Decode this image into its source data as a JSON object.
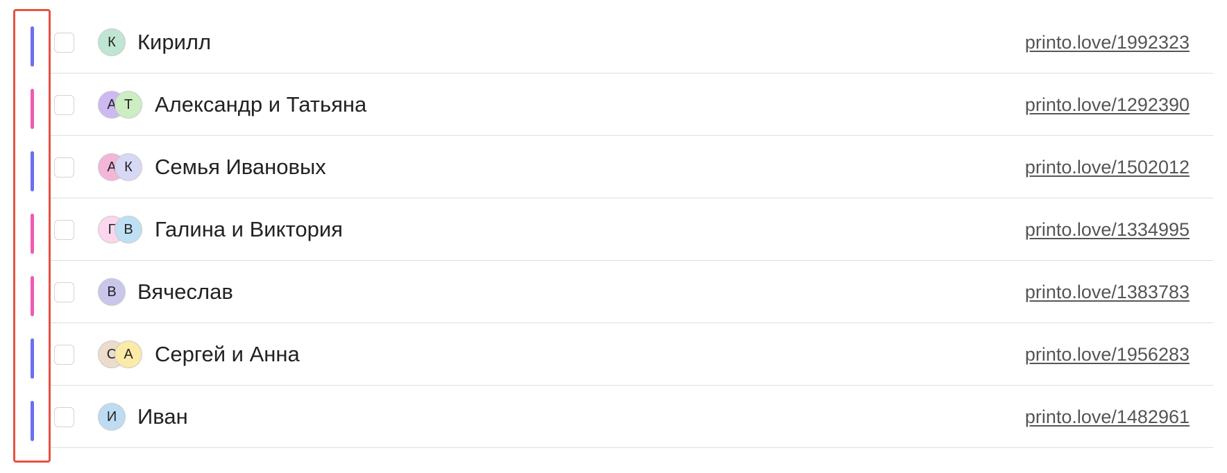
{
  "colors": {
    "accent_blue": "#6b6ff0",
    "accent_pink": "#ef5ab7",
    "highlight_border": "#e8513f"
  },
  "rows": [
    {
      "name": "Кирилл",
      "link": "printo.love/1992323",
      "accent": "#6b6ff0",
      "avatars": [
        {
          "initial": "К",
          "color": "#bfe6d2"
        }
      ]
    },
    {
      "name": "Александр и Татьяна",
      "link": "printo.love/1292390",
      "accent": "#ef5ab7",
      "avatars": [
        {
          "initial": "А",
          "color": "#cdb9f2"
        },
        {
          "initial": "Т",
          "color": "#cdeec2"
        }
      ]
    },
    {
      "name": "Семья Ивановых",
      "link": "printo.love/1502012",
      "accent": "#6b6ff0",
      "avatars": [
        {
          "initial": "А",
          "color": "#f4b6d8"
        },
        {
          "initial": "К",
          "color": "#d7d8f5"
        }
      ]
    },
    {
      "name": "Галина и Виктория",
      "link": "printo.love/1334995",
      "accent": "#ef5ab7",
      "avatars": [
        {
          "initial": "Г",
          "color": "#fbd6ec"
        },
        {
          "initial": "В",
          "color": "#bfe0f4"
        }
      ]
    },
    {
      "name": "Вячеслав",
      "link": "printo.love/1383783",
      "accent": "#ef5ab7",
      "avatars": [
        {
          "initial": "В",
          "color": "#c9c6ec"
        }
      ]
    },
    {
      "name": "Сергей и Анна",
      "link": "printo.love/1956283",
      "accent": "#6b6ff0",
      "avatars": [
        {
          "initial": "С",
          "color": "#ecdccb"
        },
        {
          "initial": "А",
          "color": "#fbeaa8"
        }
      ]
    },
    {
      "name": "Иван",
      "link": "printo.love/1482961",
      "accent": "#6b6ff0",
      "avatars": [
        {
          "initial": "И",
          "color": "#bddcf4"
        }
      ]
    }
  ]
}
